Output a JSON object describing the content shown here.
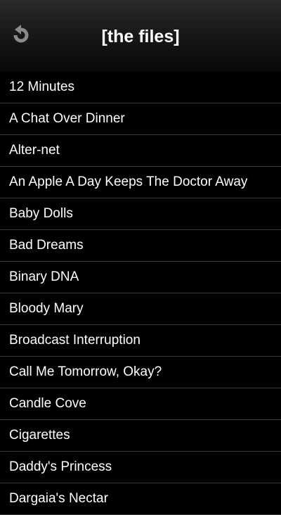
{
  "header": {
    "title": "[the files]",
    "back_icon": "back-arrow-icon"
  },
  "files": [
    "12 Minutes",
    "A Chat Over Dinner",
    "Alter-net",
    "An Apple A Day Keeps The Doctor Away",
    "Baby Dolls",
    "Bad Dreams",
    "Binary DNA",
    "Bloody Mary",
    "Broadcast Interruption",
    "Call Me Tomorrow, Okay?",
    "Candle Cove",
    "Cigarettes",
    "Daddy's Princess",
    "Dargaia's Nectar"
  ],
  "colors": {
    "background": "#000000",
    "text": "#ffffff",
    "separator": "#3a3a3a",
    "back_icon": "#8a8a8a"
  }
}
